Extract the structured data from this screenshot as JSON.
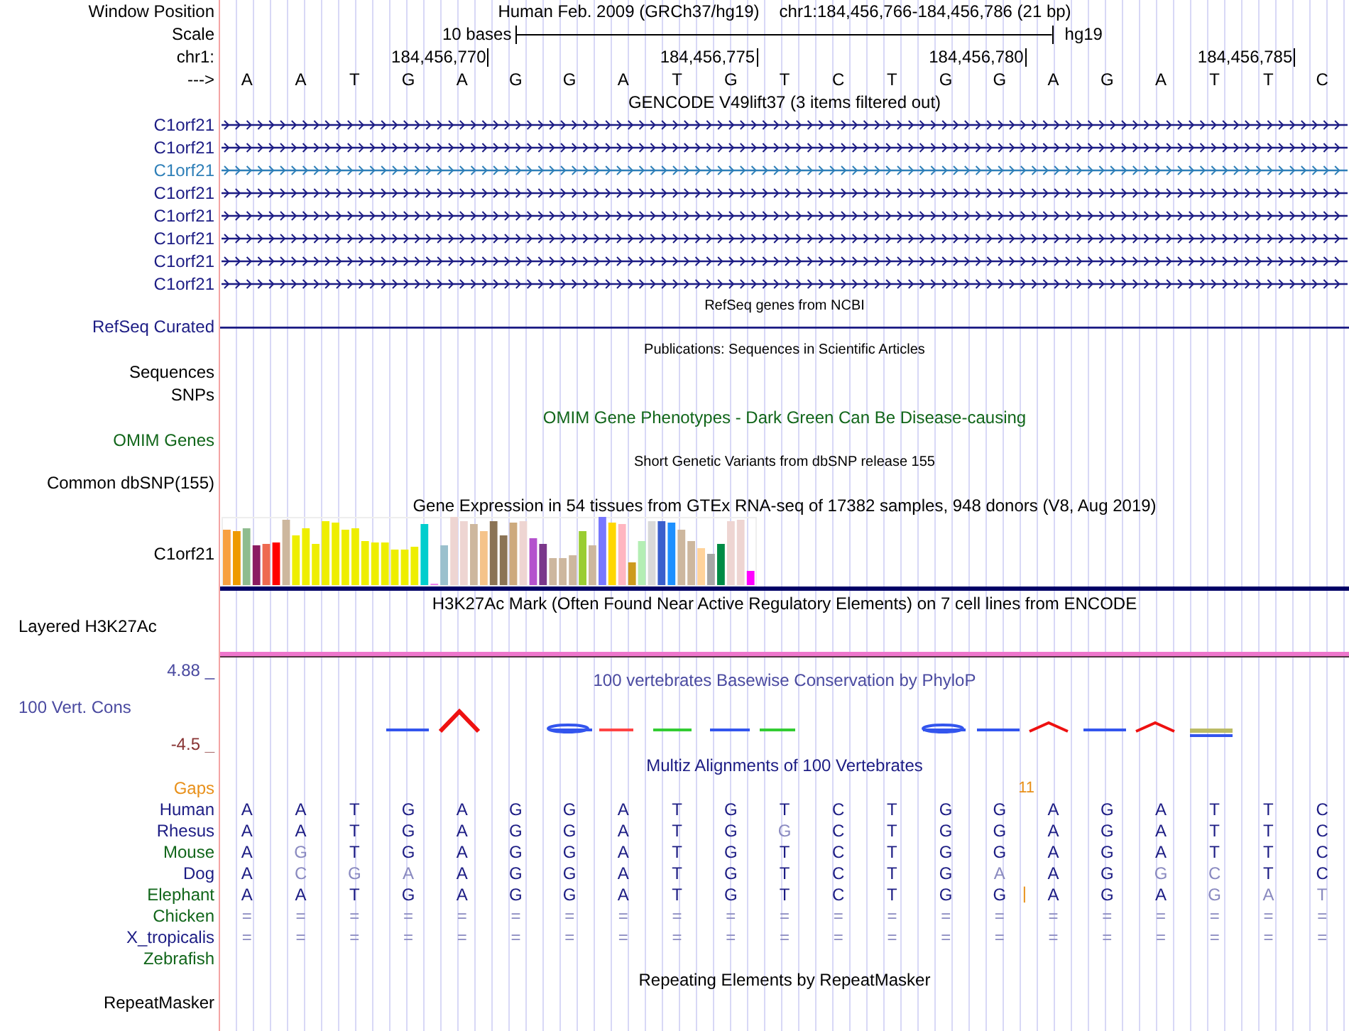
{
  "position": {
    "label": "Window Position",
    "assembly": "Human Feb. 2009 (GRCh37/hg19)",
    "range": "chr1:184,456,766-184,456,786 (21 bp)"
  },
  "scale": {
    "label": "Scale",
    "length": "10 bases",
    "assembly": "hg19"
  },
  "coordinates": {
    "label": "chr1:",
    "ticks": [
      "184,456,770",
      "184,456,775",
      "184,456,780",
      "184,456,785"
    ]
  },
  "sequence": {
    "label": "--->",
    "bases": [
      "A",
      "A",
      "T",
      "G",
      "A",
      "G",
      "G",
      "A",
      "T",
      "G",
      "T",
      "C",
      "T",
      "G",
      "G",
      "A",
      "G",
      "A",
      "T",
      "T",
      "C"
    ]
  },
  "tracks": [
    {
      "kind": "genes",
      "title": "GENCODE V49lift37 (3 items filtered out)",
      "items": [
        {
          "name": "C1orf21",
          "color": "#1c1c84"
        },
        {
          "name": "C1orf21",
          "color": "#1c1c84"
        },
        {
          "name": "C1orf21",
          "color": "#2e7fb8"
        },
        {
          "name": "C1orf21",
          "color": "#1c1c84"
        },
        {
          "name": "C1orf21",
          "color": "#1c1c84"
        },
        {
          "name": "C1orf21",
          "color": "#1c1c84"
        },
        {
          "name": "C1orf21",
          "color": "#1c1c84"
        },
        {
          "name": "C1orf21",
          "color": "#1c1c84"
        }
      ]
    },
    {
      "kind": "refseq",
      "title": "RefSeq genes from NCBI",
      "label": "RefSeq Curated"
    },
    {
      "kind": "publications",
      "title": "Publications: Sequences in Scientific Articles",
      "label": "Sequences SNPs"
    },
    {
      "kind": "omim",
      "title": "OMIM Gene Phenotypes - Dark Green Can Be Disease-causing",
      "label": "OMIM Genes"
    },
    {
      "kind": "dbsnp",
      "title": "Short Genetic Variants from dbSNP release 155",
      "label": "Common dbSNP(155)"
    },
    {
      "kind": "expression",
      "title": "Gene Expression in 54 tissues from GTEx RNA-seq of 17382 samples, 948 donors (V8, Aug 2019)",
      "label": "C1orf21"
    },
    {
      "kind": "layered",
      "title": "H3K27Ac Mark (Often Found Near Active Regulatory Elements) on 7 cell lines from ENCODE",
      "label": "Layered H3K27Ac"
    },
    {
      "kind": "conservation",
      "title": "100 vertebrates Basewise Conservation by PhyloP",
      "label": "100 Vert. Cons",
      "max": "4.88 _",
      "min": "-4.5 _"
    },
    {
      "kind": "multiz",
      "title": "Multiz Alignments of 100 Vertebrates",
      "gaps": {
        "label": "Gaps",
        "count": "11"
      },
      "species": [
        {
          "name": "Human",
          "color": "#1c1c84",
          "bases": [
            "A",
            "A",
            "T",
            "G",
            "A",
            "G",
            "G",
            "A",
            "T",
            "G",
            "T",
            "C",
            "T",
            "G",
            "G",
            "A",
            "G",
            "A",
            "T",
            "T",
            "C"
          ]
        },
        {
          "name": "Rhesus",
          "color": "#1c1c84",
          "bases": [
            "A",
            "A",
            "T",
            "G",
            "A",
            "G",
            "G",
            "A",
            "T",
            "G",
            "G",
            "C",
            "T",
            "G",
            "G",
            "A",
            "G",
            "A",
            "T",
            "T",
            "C"
          ]
        },
        {
          "name": "Mouse",
          "color": "#11661a",
          "bases": [
            "A",
            "G",
            "T",
            "G",
            "A",
            "G",
            "G",
            "A",
            "T",
            "G",
            "T",
            "C",
            "T",
            "G",
            "G",
            "A",
            "G",
            "A",
            "T",
            "T",
            "C"
          ]
        },
        {
          "name": "Dog",
          "color": "#1c1c84",
          "bases": [
            "A",
            "C",
            "G",
            "A",
            "A",
            "G",
            "G",
            "A",
            "T",
            "G",
            "T",
            "C",
            "T",
            "G",
            "A",
            "A",
            "G",
            "G",
            "C",
            "T",
            "C"
          ]
        },
        {
          "name": "Elephant",
          "color": "#11661a",
          "bases": [
            "A",
            "A",
            "T",
            "G",
            "A",
            "G",
            "G",
            "A",
            "T",
            "G",
            "T",
            "C",
            "T",
            "G",
            "G",
            "|",
            "A",
            "G",
            "A",
            "G",
            "A",
            "T"
          ]
        },
        {
          "name": "Chicken",
          "color": "#11661a",
          "bases": [
            "=",
            "=",
            "=",
            "=",
            "=",
            "=",
            "=",
            "=",
            "=",
            "=",
            "=",
            "=",
            "=",
            "=",
            "=",
            "=",
            "=",
            "=",
            "=",
            "=",
            "="
          ]
        },
        {
          "name": "X_tropicalis",
          "color": "#1c1c84",
          "bases": [
            "=",
            "=",
            "=",
            "=",
            "=",
            "=",
            "=",
            "=",
            "=",
            "=",
            "=",
            "=",
            "=",
            "=",
            "=",
            "=",
            "=",
            "=",
            "=",
            "=",
            "="
          ]
        },
        {
          "name": "Zebrafish",
          "color": "#11661a"
        }
      ]
    },
    {
      "kind": "repeats",
      "title": "Repeating Elements by RepeatMasker",
      "label": "RepeatMasker"
    }
  ]
}
